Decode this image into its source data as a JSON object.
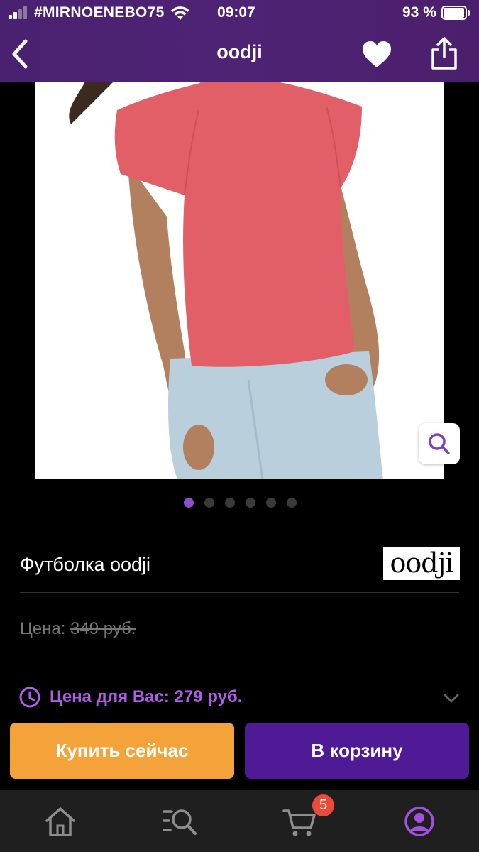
{
  "status_bar": {
    "carrier": "#MIRNOENEBO75",
    "time": "09:07",
    "battery": "93 %"
  },
  "nav": {
    "title": "oodji"
  },
  "gallery": {
    "image_alt": "Woman wearing a coral t-shirt and light blue jeans",
    "pages": 6,
    "active_page": 1
  },
  "product": {
    "name": "Футболка oodji",
    "brand_logo": "oodji"
  },
  "price": {
    "label": "Цена:",
    "old": "349 руб.",
    "your_price": "Цена для Вас: 279 руб."
  },
  "actions": {
    "buy_now": "Купить сейчас",
    "add_to_cart": "В корзину"
  },
  "tab_bar": {
    "cart_badge": "5",
    "items": [
      "home-icon",
      "catalog-search-icon",
      "cart-icon",
      "profile-icon"
    ]
  },
  "colors": {
    "header": "#4e2375",
    "accent_purple": "#b05ee8",
    "buy_now": "#f3a33a",
    "add_to_cart": "#4e1a96",
    "badge": "#e94a39",
    "tab_bar": "#1f1f1f"
  }
}
